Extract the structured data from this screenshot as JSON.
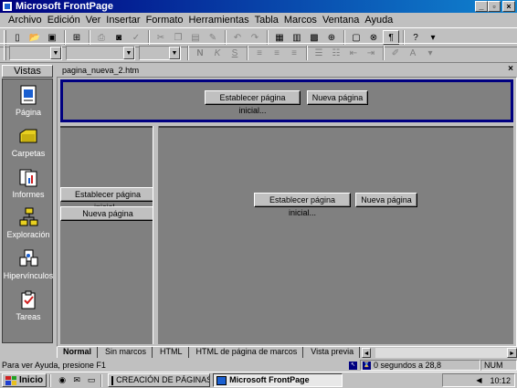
{
  "window": {
    "title": "Microsoft FrontPage"
  },
  "menu": [
    "Archivo",
    "Edición",
    "Ver",
    "Insertar",
    "Formato",
    "Herramientas",
    "Tabla",
    "Marcos",
    "Ventana",
    "Ayuda"
  ],
  "views": {
    "title": "Vistas",
    "items": [
      "Página",
      "Carpetas",
      "Informes",
      "Exploración",
      "Hipervínculos",
      "Tareas"
    ]
  },
  "document": {
    "filename": "pagina_nueva_2.htm"
  },
  "frames": {
    "top": {
      "set_initial": "Establecer página inicial...",
      "new_page": "Nueva página"
    },
    "left": {
      "set_initial": "Establecer página inicial...",
      "new_page": "Nueva página"
    },
    "main": {
      "set_initial": "Establecer página inicial...",
      "new_page": "Nueva página"
    }
  },
  "tabs": [
    "Normal",
    "Sin marcos",
    "HTML",
    "HTML de página de marcos",
    "Vista previa"
  ],
  "status": {
    "text": "Para ver Ayuda, presione F1",
    "time": "0 segundos a 28,8",
    "num": "NUM"
  },
  "taskbar": {
    "start": "Inicio",
    "tasks": [
      "CREACIÓN DE PÁGINAS ...",
      "Microsoft FrontPage"
    ],
    "clock": "10:12"
  }
}
